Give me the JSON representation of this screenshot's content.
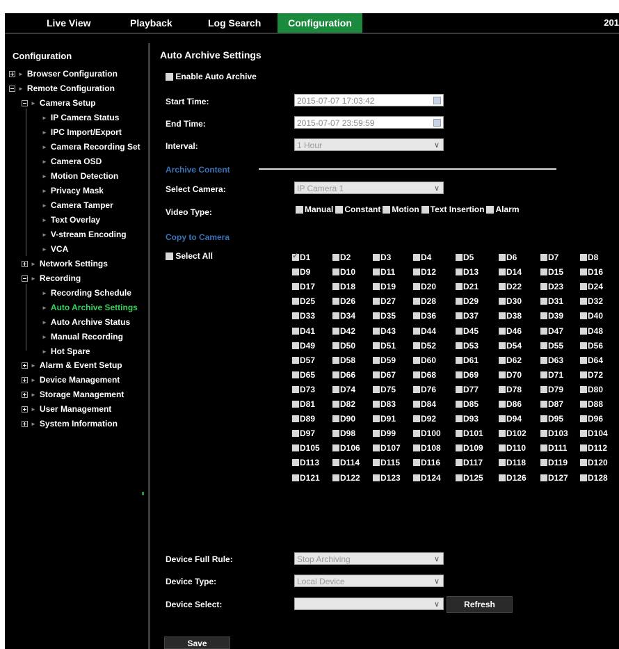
{
  "nav": {
    "tabs": [
      {
        "label": "Live View"
      },
      {
        "label": "Playback"
      },
      {
        "label": "Log Search"
      },
      {
        "label": "Configuration"
      }
    ],
    "clock": "201"
  },
  "sidebar": {
    "title": "Configuration",
    "items": [
      {
        "label": "Browser Configuration"
      },
      {
        "label": "Remote Configuration"
      },
      {
        "label": "Camera Setup"
      },
      {
        "label": "IP Camera Status"
      },
      {
        "label": "IPC Import/Export"
      },
      {
        "label": "Camera Recording Set"
      },
      {
        "label": "Camera OSD"
      },
      {
        "label": "Motion Detection"
      },
      {
        "label": "Privacy Mask"
      },
      {
        "label": "Camera Tamper"
      },
      {
        "label": "Text Overlay"
      },
      {
        "label": "V-stream Encoding"
      },
      {
        "label": "VCA"
      },
      {
        "label": "Network Settings"
      },
      {
        "label": "Recording"
      },
      {
        "label": "Recording Schedule"
      },
      {
        "label": "Auto Archive Settings"
      },
      {
        "label": "Auto Archive Status"
      },
      {
        "label": "Manual Recording"
      },
      {
        "label": "Hot Spare"
      },
      {
        "label": "Alarm & Event Setup"
      },
      {
        "label": "Device Management"
      },
      {
        "label": "Storage Management"
      },
      {
        "label": "User Management"
      },
      {
        "label": "System Information"
      }
    ]
  },
  "main": {
    "title": "Auto Archive Settings",
    "enable_label": "Enable Auto Archive",
    "start_label": "Start Time:",
    "start_value": "2015-07-07 17:03:42",
    "end_label": "End Time:",
    "end_value": "2015-07-07 23:59:59",
    "interval_label": "Interval:",
    "interval_value": "1 Hour",
    "archive_content": "Archive Content",
    "select_camera_label": "Select Camera:",
    "select_camera_value": "IP Camera 1",
    "video_type_label": "Video Type:",
    "video_types": [
      "Manual",
      "Constant",
      "Motion",
      "Text Insertion",
      "Alarm"
    ],
    "copy_to_camera": "Copy to Camera",
    "select_all": "Select All",
    "device_full_label": "Device Full Rule:",
    "device_full_value": "Stop Archiving",
    "device_type_label": "Device Type:",
    "device_type_value": "Local Device",
    "device_select_label": "Device Select:",
    "device_select_value": "",
    "refresh": "Refresh",
    "save": "Save"
  }
}
